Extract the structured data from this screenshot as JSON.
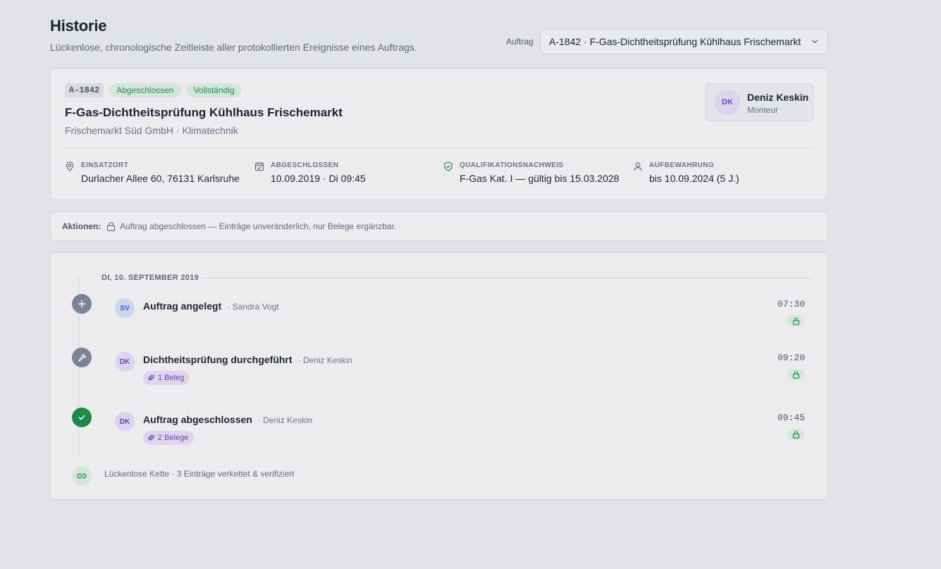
{
  "header": {
    "title": "Historie",
    "subtitle": "Lückenlose, chronologische Zeitleiste aller protokollierten Ereignisse eines Auftrags.",
    "select_label": "Auftrag",
    "select_value": "A-1842 · F-Gas-Dichtheitsprüfung Kühlhaus Frischemarkt"
  },
  "job": {
    "id": "A-1842",
    "tags": [
      "Abgeschlossen",
      "Vollständig"
    ],
    "title": "F-Gas-Dichtheitsprüfung Kühlhaus Frischemarkt",
    "subtitle": "Frischemarkt Süd GmbH · Klimatechnik",
    "person": {
      "initials": "DK",
      "name": "Deniz Keskin",
      "role": "Monteur"
    },
    "meta": [
      {
        "icon": "map-pin-icon",
        "label": "EINSATZORT",
        "value": "Durlacher Allee 60, 76131 Karlsruhe"
      },
      {
        "icon": "calendar-check-icon",
        "label": "ABGESCHLOSSEN",
        "value": "10.09.2019 · Di 09:45"
      },
      {
        "icon": "shield-check-icon",
        "label": "QUALIFIKATIONSNACHWEIS",
        "value": "F-Gas Kat. I — gültig bis 15.03.2028"
      },
      {
        "icon": "user-icon",
        "label": "AUFBEWAHRUNG",
        "value": "bis 10.09.2024 (5 J.)"
      }
    ]
  },
  "actions": {
    "label": "Aktionen:",
    "text": "Auftrag abgeschlossen — Einträge unveränderlich, nur Belege ergänzbar."
  },
  "timeline": {
    "day_label": "DI, 10. SEPTEMBER 2019",
    "events": [
      {
        "icon": "plus-icon",
        "initials": "SV",
        "title": "Auftrag angelegt",
        "by": "· Sandra Vogt",
        "time": "07:30",
        "attachments": ""
      },
      {
        "icon": "wrench-icon",
        "initials": "DK",
        "title": "Dichtheitsprüfung durchgeführt",
        "by": "· Deniz Keskin",
        "time": "09:20",
        "attachments": "1 Beleg"
      },
      {
        "icon": "check-icon",
        "initials": "DK",
        "title": "Auftrag abgeschlossen",
        "by": "· Deniz Keskin",
        "time": "09:45",
        "attachments": "2 Belege"
      }
    ],
    "chain_text": "Lückenlose Kette · 3 Einträge verkettet & verifiziert"
  },
  "colors": {
    "background": "#e2e3e7",
    "success": "#1f8a48",
    "success_bg": "#d3e6da",
    "purple": "#6b3fb5",
    "neutral_dot": "#7b8396",
    "blue_avatar": "#3159b0"
  }
}
